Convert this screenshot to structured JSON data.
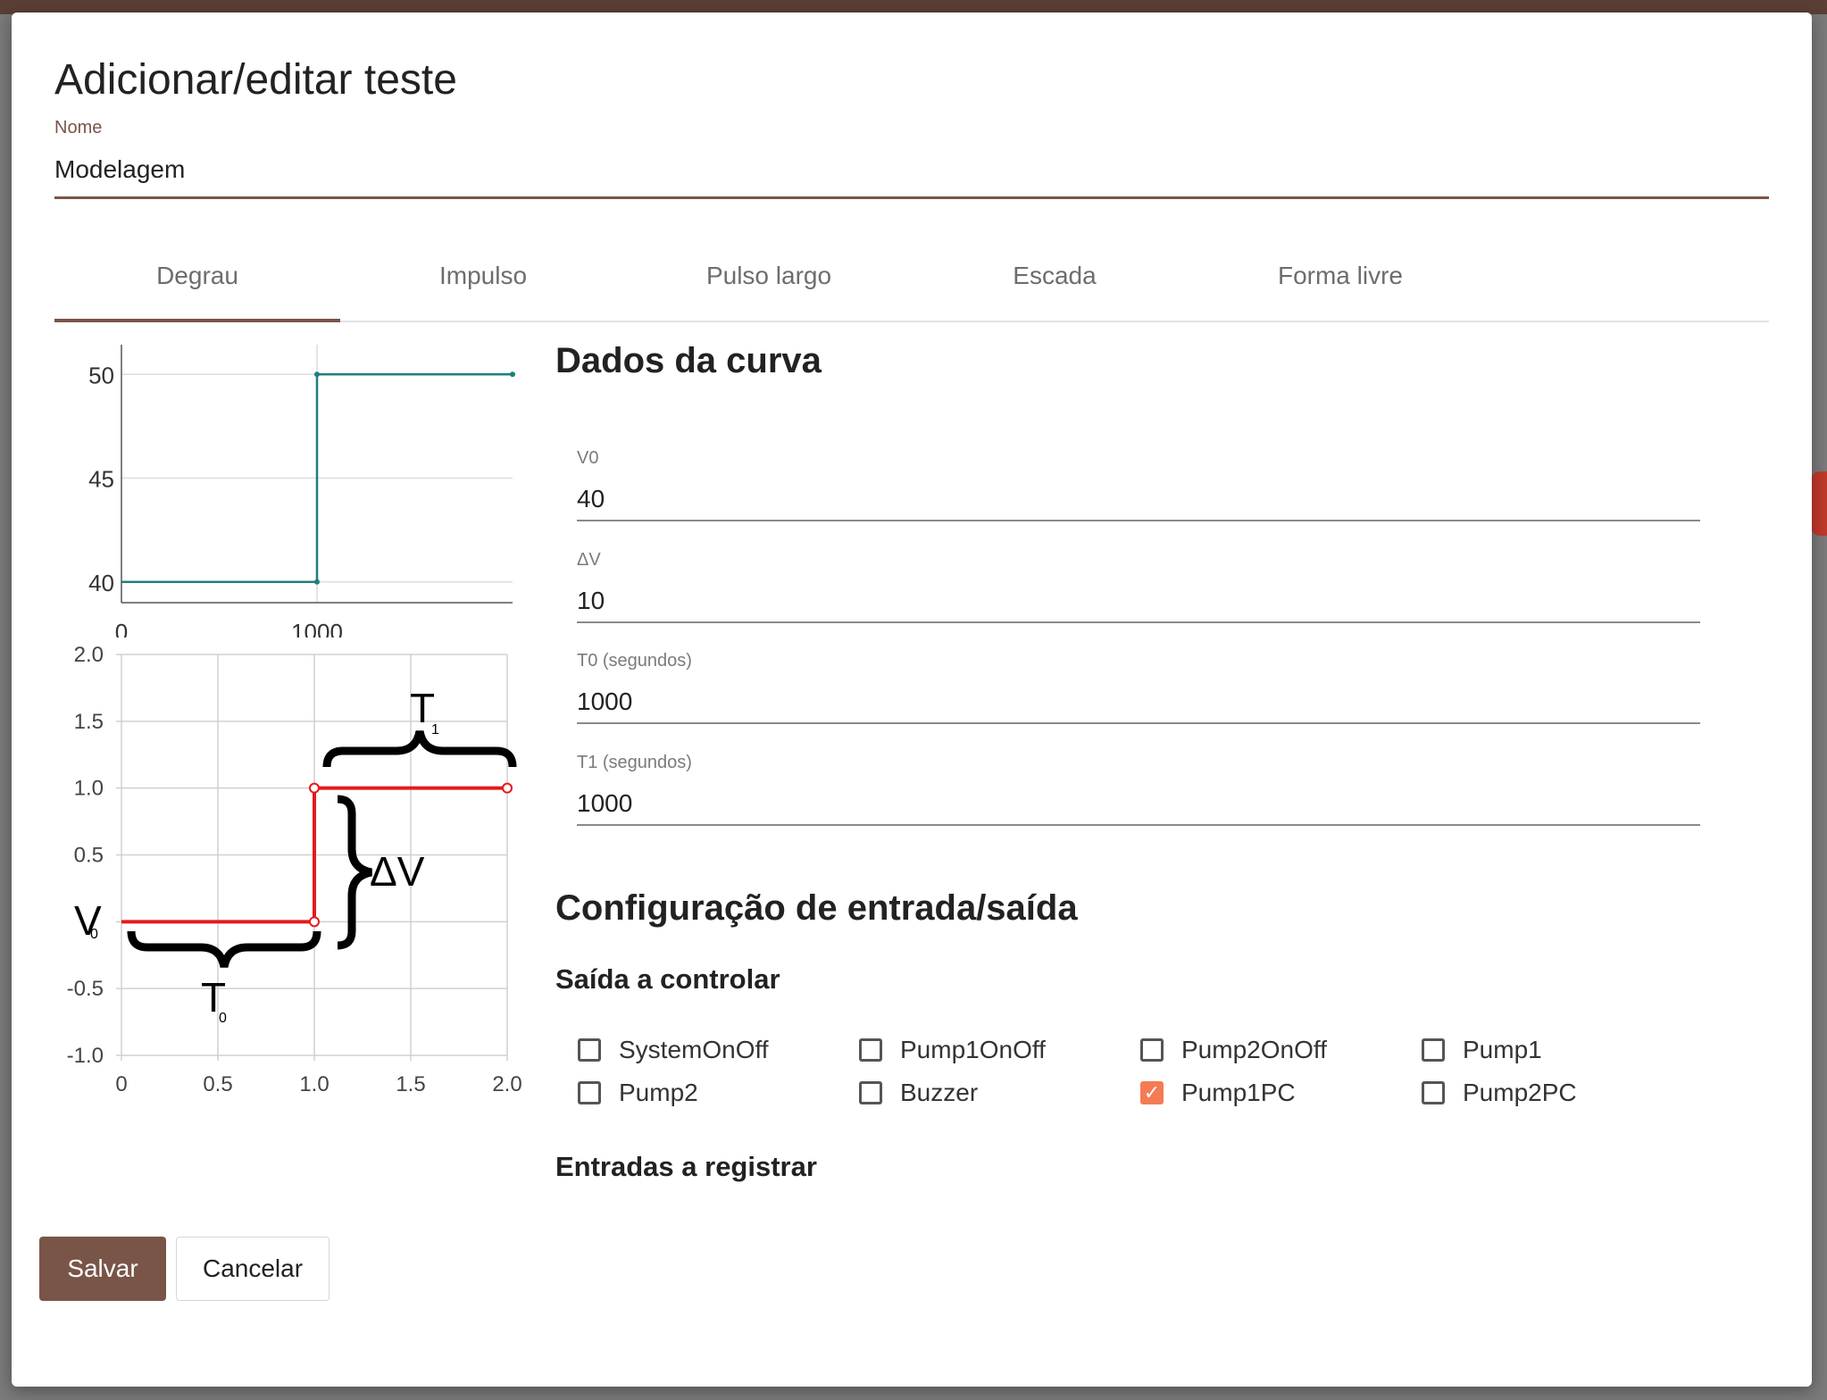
{
  "dialog": {
    "title": "Adicionar/editar teste"
  },
  "name": {
    "label": "Nome",
    "value": "Modelagem"
  },
  "tabs": [
    {
      "label": "Degrau",
      "active": true
    },
    {
      "label": "Impulso",
      "active": false
    },
    {
      "label": "Pulso largo",
      "active": false
    },
    {
      "label": "Escada",
      "active": false
    },
    {
      "label": "Forma livre",
      "active": false
    }
  ],
  "curve": {
    "heading": "Dados da curva",
    "fields": [
      {
        "label": "V0",
        "value": "40"
      },
      {
        "label": "ΔV",
        "value": "10"
      },
      {
        "label": "T0 (segundos)",
        "value": "1000"
      },
      {
        "label": "T1 (segundos)",
        "value": "1000"
      }
    ]
  },
  "io": {
    "heading": "Configuração de entrada/saída",
    "outputs_heading": "Saída a controlar",
    "outputs": [
      {
        "label": "SystemOnOff",
        "checked": false
      },
      {
        "label": "Pump1OnOff",
        "checked": false
      },
      {
        "label": "Pump2OnOff",
        "checked": false
      },
      {
        "label": "Pump1",
        "checked": false
      },
      {
        "label": "Pump2",
        "checked": false
      },
      {
        "label": "Buzzer",
        "checked": false
      },
      {
        "label": "Pump1PC",
        "checked": true
      },
      {
        "label": "Pump2PC",
        "checked": false
      }
    ],
    "inputs_heading": "Entradas a registrar"
  },
  "buttons": {
    "save": "Salvar",
    "cancel": "Cancelar"
  },
  "colors": {
    "accent": "#795548",
    "check": "#f47b54",
    "preview_line": "#1f7f7a",
    "diagram_line": "#e41a1c"
  },
  "chart_data": [
    {
      "type": "line",
      "x": [
        0,
        1000,
        1000,
        2000
      ],
      "y": [
        40,
        40,
        50,
        50
      ],
      "xticks": [
        "0",
        "1000"
      ],
      "yticks": [
        "40",
        "45",
        "50"
      ],
      "xlim": [
        0,
        2000
      ],
      "ylim": [
        39,
        51
      ],
      "grid": true
    },
    {
      "type": "line",
      "x": [
        0,
        1.0,
        1.0,
        2.0
      ],
      "y": [
        0,
        0,
        1.0,
        1.0
      ],
      "xticks": [
        "0",
        "0.5",
        "1.0",
        "1.5",
        "2.0"
      ],
      "yticks": [
        "2.0",
        "1.5",
        "1.0",
        "0.5",
        "",
        "-0.5",
        "-1.0"
      ],
      "xlim": [
        0,
        2.0
      ],
      "ylim": [
        -1.0,
        2.0
      ],
      "grid": true,
      "annotations": {
        "t1": {
          "main": "T",
          "sub": "1"
        },
        "dv": "ΔV",
        "v0": {
          "main": "V",
          "sub": "0"
        },
        "t0": {
          "main": "T",
          "sub": "0"
        }
      }
    }
  ]
}
